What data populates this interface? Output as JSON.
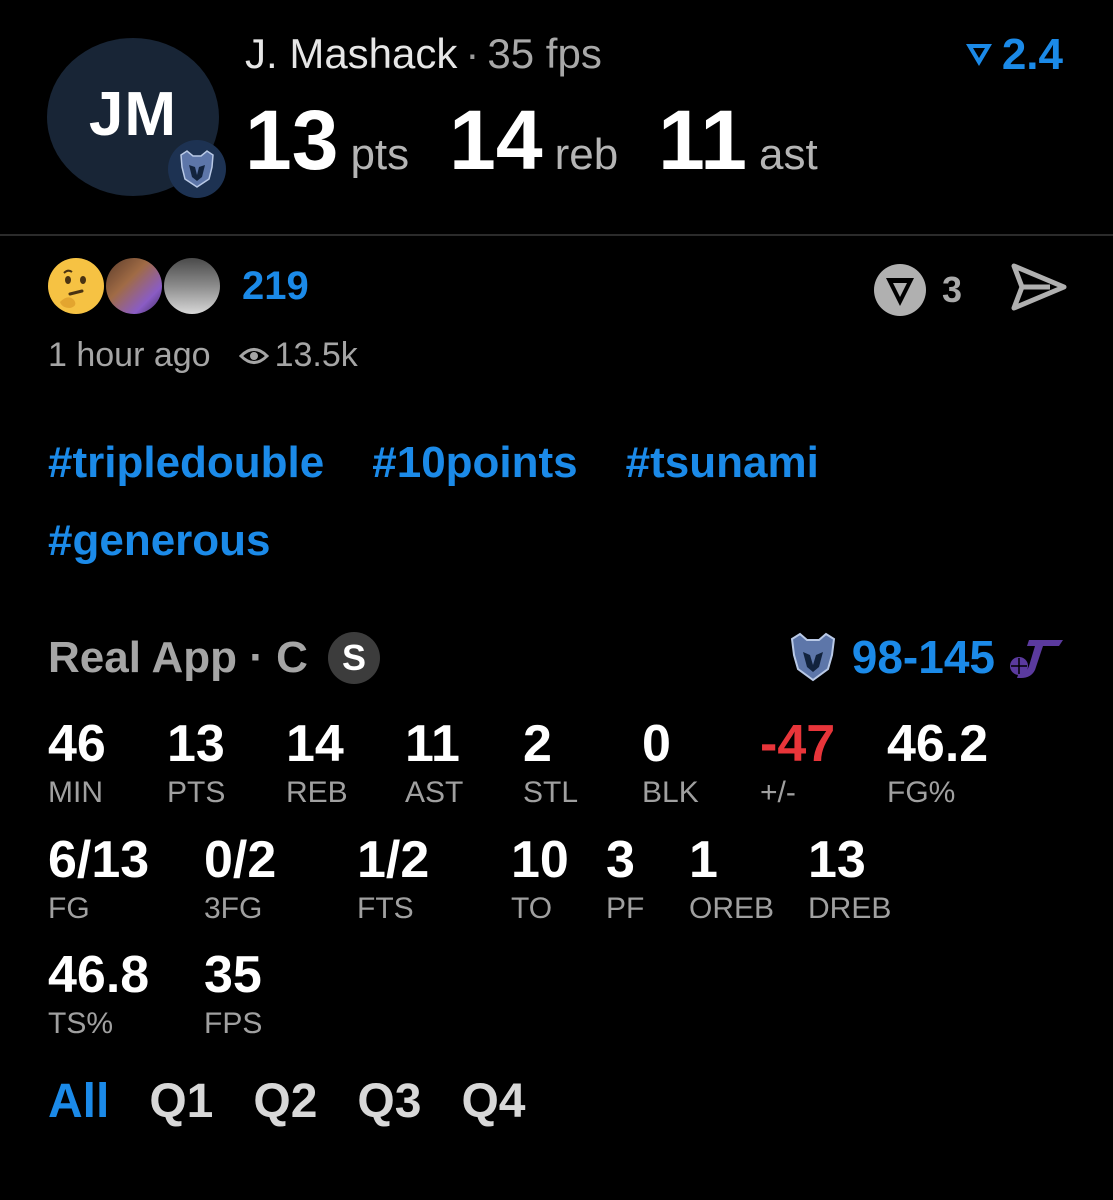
{
  "player": {
    "initials": "JM",
    "name": "J. Mashack",
    "separator": "·",
    "fps_label": "35 fps",
    "rating": "2.4"
  },
  "headline": [
    {
      "value": "13",
      "unit": "pts"
    },
    {
      "value": "14",
      "unit": "reb"
    },
    {
      "value": "11",
      "unit": "ast"
    }
  ],
  "reactions": {
    "count": "219",
    "votes": "3",
    "icons": [
      "thinking-face-emoji",
      "player-photo-reaction",
      "player-photo-reaction"
    ]
  },
  "meta": {
    "time_ago": "1 hour ago",
    "views": "13.5k"
  },
  "hashtags": [
    "#tripledouble",
    "#10points",
    "#tsunami",
    "#generous"
  ],
  "game": {
    "source": "Real App · C",
    "badge": "S",
    "score": "98-145",
    "home_team_icon": "grizzlies-logo-icon",
    "away_team_icon": "jazz-logo-icon"
  },
  "stats": {
    "row1": [
      {
        "value": "46",
        "label": "MIN"
      },
      {
        "value": "13",
        "label": "PTS"
      },
      {
        "value": "14",
        "label": "REB"
      },
      {
        "value": "11",
        "label": "AST"
      },
      {
        "value": "2",
        "label": "STL"
      },
      {
        "value": "0",
        "label": "BLK"
      },
      {
        "value": "-47",
        "label": "+/-"
      },
      {
        "value": "46.2",
        "label": "FG%"
      }
    ],
    "row2": [
      {
        "value": "6/13",
        "label": "FG"
      },
      {
        "value": "0/2",
        "label": "3FG"
      },
      {
        "value": "1/2",
        "label": "FTS"
      },
      {
        "value": "10",
        "label": "TO"
      },
      {
        "value": "3",
        "label": "PF"
      },
      {
        "value": "1",
        "label": "OREB"
      },
      {
        "value": "13",
        "label": "DREB"
      }
    ],
    "row3": [
      {
        "value": "46.8",
        "label": "TS%"
      },
      {
        "value": "35",
        "label": "FPS"
      }
    ]
  },
  "periods": [
    "All",
    "Q1",
    "Q2",
    "Q3",
    "Q4"
  ],
  "colors": {
    "accent": "#1b8ae8",
    "negative": "#e8353a",
    "background": "#000000"
  }
}
